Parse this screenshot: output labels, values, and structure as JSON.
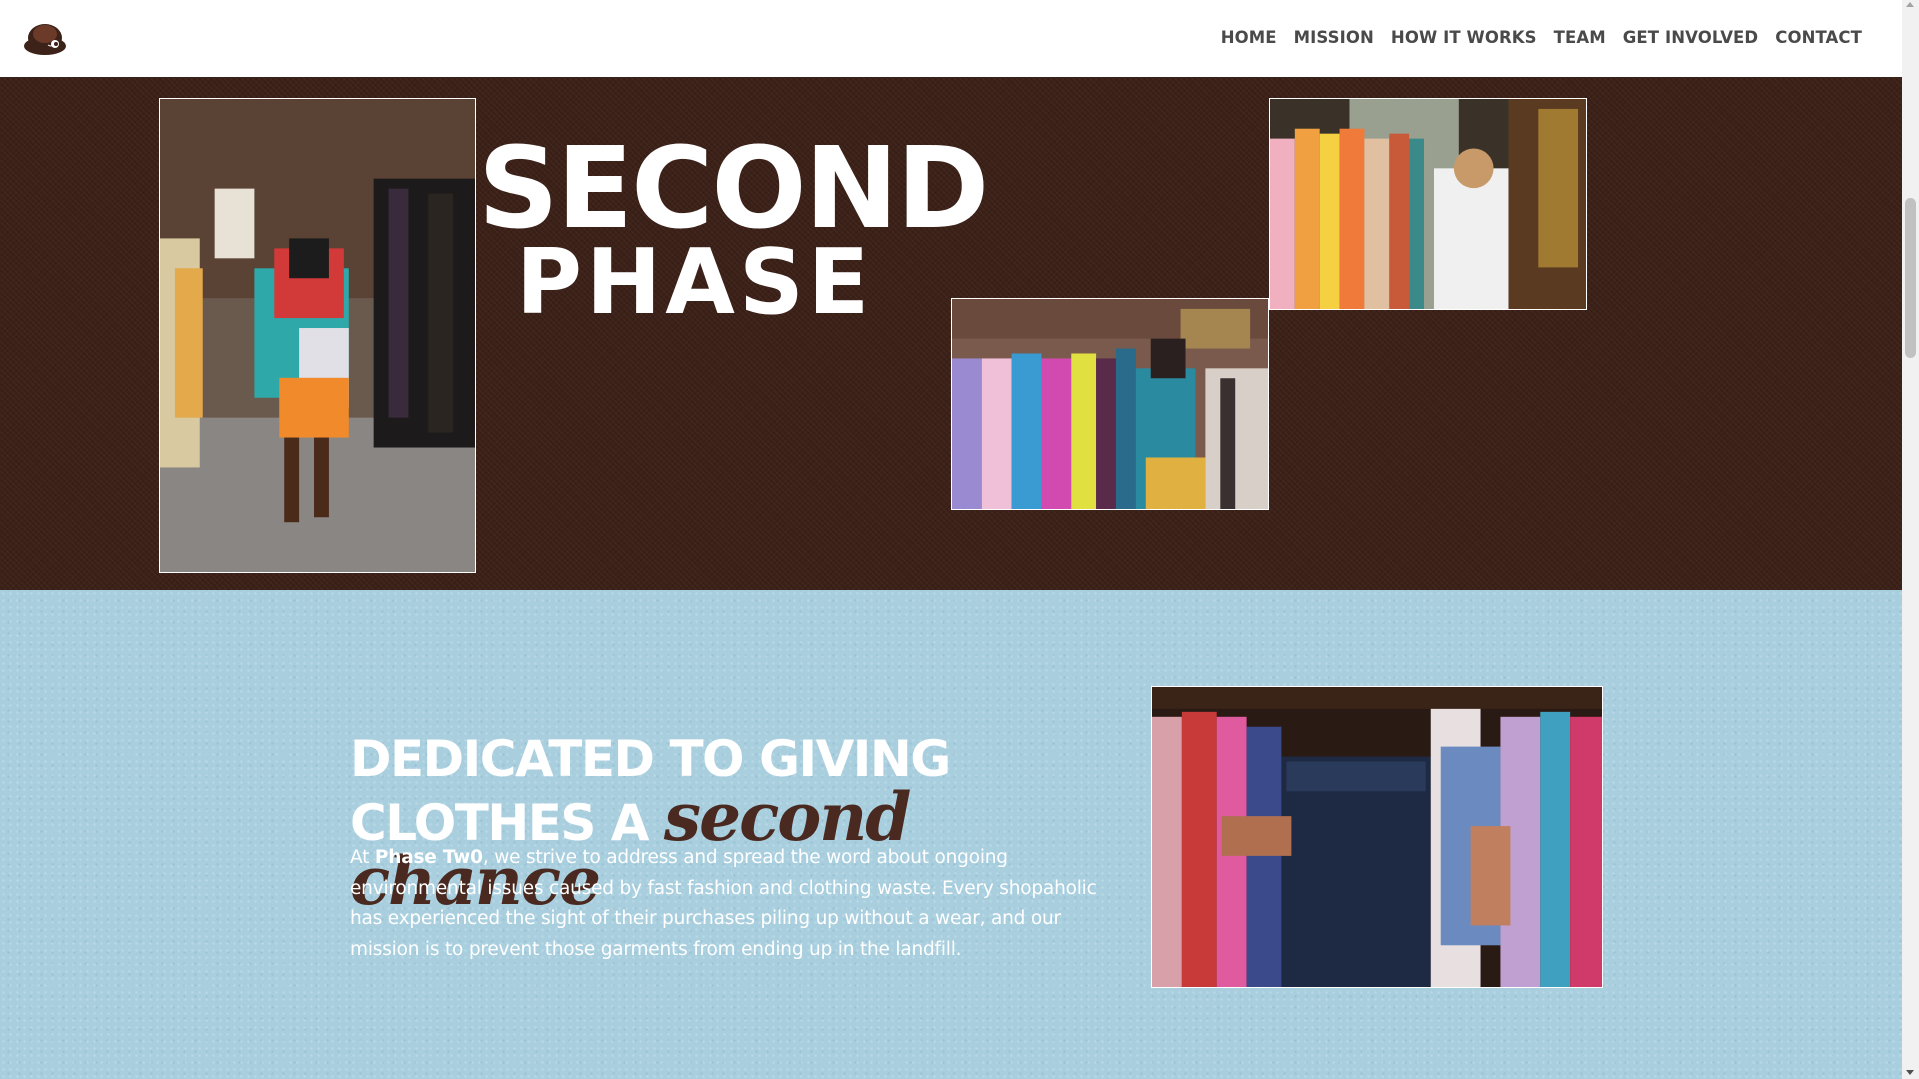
{
  "header": {
    "logo_icon": "turtle-logo-icon",
    "nav": [
      "HOME",
      "MISSION",
      "HOW IT WORKS",
      "TEAM",
      "GET INVOLVED",
      "CONTACT"
    ]
  },
  "hero": {
    "title_line1": "SECOND",
    "title_line2": "PHASE",
    "background_color": "#3c2118"
  },
  "mission": {
    "heading_line1": "DEDICATED TO GIVING",
    "heading_line2": "CLOTHES A",
    "heading_script": "second chance",
    "body_prefix": "At",
    "body_brand": "Phase Tw0",
    "body_text": ", we strive to address and spread the word about ongoing environmental issues caused by fast fashion and clothing waste. Every shopaholic has experienced the sight of their purchases piling up without a wear, and our mission is to prevent those garments from ending up in the landfill.",
    "background_color": "#a9cfdf",
    "script_color": "#4a2a20"
  }
}
